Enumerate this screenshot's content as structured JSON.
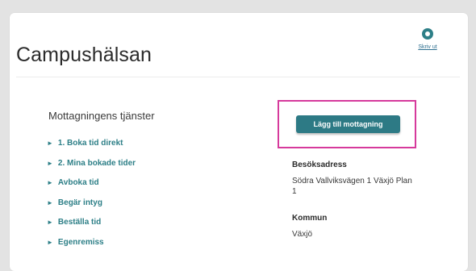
{
  "page": {
    "title": "Campushälsan",
    "print_label": "Skriv ut"
  },
  "services": {
    "heading": "Mottagningens tjänster",
    "items": [
      {
        "label": "1. Boka tid direkt"
      },
      {
        "label": "2. Mina bokade tider"
      },
      {
        "label": "Avboka tid"
      },
      {
        "label": "Begär intyg"
      },
      {
        "label": "Beställa tid"
      },
      {
        "label": "Egenremiss"
      }
    ]
  },
  "sidebar": {
    "add_button_label": "Lägg till mottagning",
    "address_heading": "Besöksadress",
    "address_line1": "Södra Vallviksvägen 1 Växjö Plan",
    "address_line2": "1",
    "municipality_heading": "Kommun",
    "municipality_value": "Växjö"
  },
  "colors": {
    "accent": "#2d7a85",
    "highlight": "#d63a9c",
    "background": "#e3e3e3"
  }
}
